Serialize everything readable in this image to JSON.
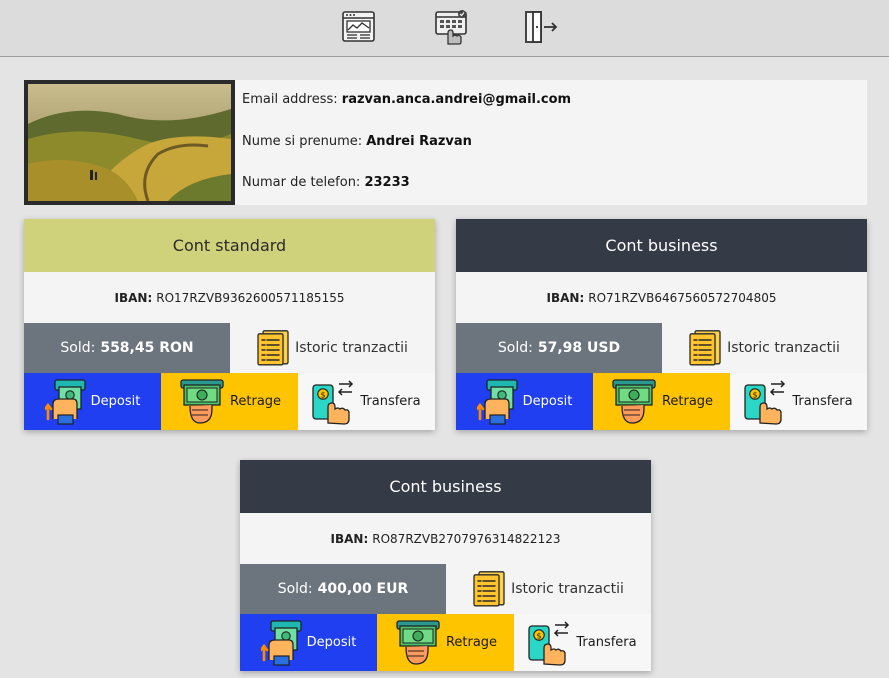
{
  "toolbar": {
    "buttons": [
      {
        "icon": "dashboard-window-icon"
      },
      {
        "icon": "payment-terminal-icon"
      },
      {
        "icon": "logout-door-icon"
      }
    ]
  },
  "profile": {
    "email_label": "Email address:",
    "email_value": "razvan.anca.andrei@gmail.com",
    "name_label": "Nume si prenume:",
    "name_value": "Andrei Razvan",
    "phone_label": "Numar de telefon:",
    "phone_value": "23233"
  },
  "colors": {
    "standard_header": "#cfd27a",
    "business_header": "#343a46",
    "deposit": "#1f3ff0",
    "retrage": "#ffc400",
    "transfera": "#f7f7f7",
    "sold": "#6c757d"
  },
  "accounts": [
    {
      "type": "Cont standard",
      "iban_label": "IBAN:",
      "iban": "RO17RZVB9362600571185155",
      "sold_label": "Sold:",
      "sold_value": "558,45 RON",
      "history_label": "Istoric tranzactii",
      "deposit_label": "Deposit",
      "withdraw_label": "Retrage",
      "transfer_label": "Transfera"
    },
    {
      "type": "Cont business",
      "iban_label": "IBAN:",
      "iban": "RO71RZVB6467560572704805",
      "sold_label": "Sold:",
      "sold_value": "57,98 USD",
      "history_label": "Istoric tranzactii",
      "deposit_label": "Deposit",
      "withdraw_label": "Retrage",
      "transfer_label": "Transfera"
    },
    {
      "type": "Cont business",
      "iban_label": "IBAN:",
      "iban": "RO87RZVB2707976314822123",
      "sold_label": "Sold:",
      "sold_value": "400,00 EUR",
      "history_label": "Istoric tranzactii",
      "deposit_label": "Deposit",
      "withdraw_label": "Retrage",
      "transfer_label": "Transfera"
    }
  ]
}
